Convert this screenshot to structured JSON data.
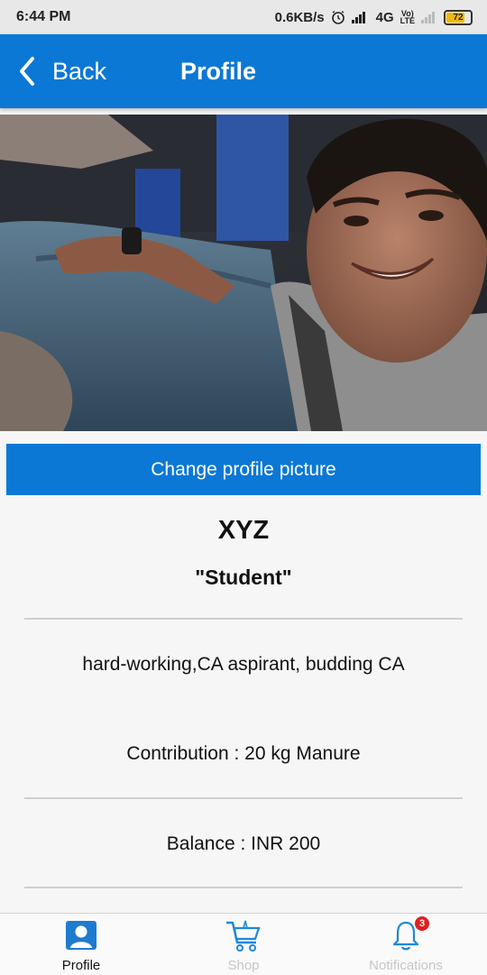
{
  "status_bar": {
    "time": "6:44 PM",
    "net_speed": "0.6KB/s",
    "network": "4G",
    "volte_top": "Vo)",
    "volte_bottom": "LTE",
    "battery": "72"
  },
  "header": {
    "back_label": "Back",
    "title": "Profile"
  },
  "profile": {
    "change_picture_label": "Change profile picture",
    "name": "XYZ",
    "role": "\"Student\"",
    "bio": "hard-working,CA aspirant, budding CA",
    "contribution": "Contribution : 20 kg Manure",
    "balance": "Balance : INR 200"
  },
  "bottom_nav": {
    "items": [
      {
        "label": "Profile",
        "icon": "profile-icon",
        "active": true
      },
      {
        "label": "Shop",
        "icon": "cart-icon",
        "active": false
      },
      {
        "label": "Notifications",
        "icon": "bell-icon",
        "active": false,
        "badge": "3"
      }
    ]
  },
  "colors": {
    "accent": "#0b78d6",
    "badge": "#e02020"
  }
}
